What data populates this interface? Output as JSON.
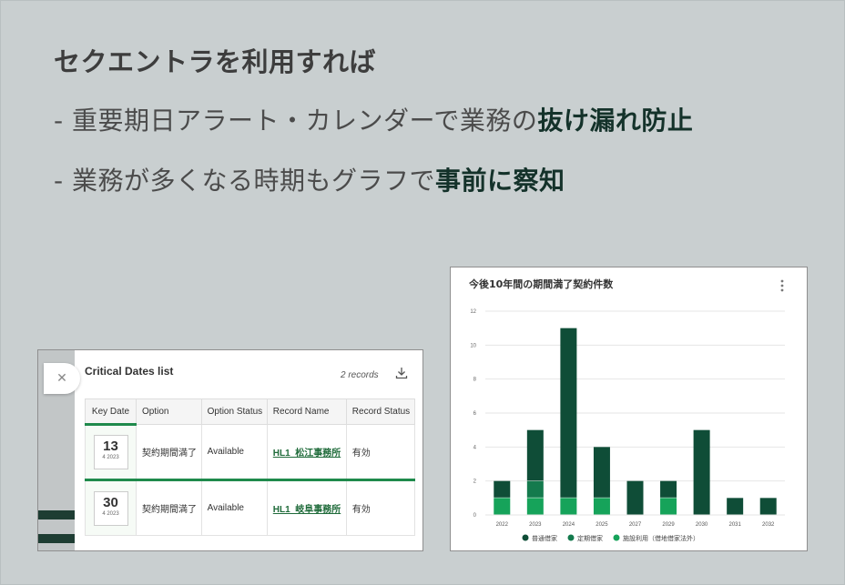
{
  "headline": "セクエントラを利用すれば",
  "bullets": [
    {
      "prefix": "- 重要期日アラート・カレンダーで業務の",
      "emphasis": "抜け漏れ防止"
    },
    {
      "prefix": "- 業務が多くなる時期もグラフで",
      "emphasis": "事前に察知"
    }
  ],
  "critical_dates": {
    "title": "Critical Dates list",
    "records": "2 records",
    "columns": [
      "Key Date",
      "Option",
      "Option Status",
      "Record Name",
      "Record Status"
    ],
    "rows": [
      {
        "day": "13",
        "month_year": "4 2023",
        "option": "契約期間満了",
        "option_status": "Available",
        "record_name": "HL1_松江事務所",
        "record_status": "有効"
      },
      {
        "day": "30",
        "month_year": "4 2023",
        "option": "契約期間満了",
        "option_status": "Available",
        "record_name": "HL1_岐阜事務所",
        "record_status": "有効"
      }
    ]
  },
  "chart_data": {
    "type": "bar",
    "stacked": true,
    "title": "今後10年間の期間満了契約件数",
    "categories": [
      "2022",
      "2023",
      "2024",
      "2025",
      "2027",
      "2029",
      "2030",
      "2031",
      "2032"
    ],
    "series": [
      {
        "name": "普通借家",
        "color": "#0f4d37",
        "values": [
          1,
          3,
          10,
          3,
          2,
          1,
          5,
          1,
          1
        ]
      },
      {
        "name": "定期借家",
        "color": "#147a4d",
        "values": [
          0,
          1,
          0,
          0,
          0,
          0,
          0,
          0,
          0
        ]
      },
      {
        "name": "施設利用（借地借家法外）",
        "color": "#16a35a",
        "values": [
          1,
          1,
          1,
          1,
          0,
          1,
          0,
          0,
          0
        ]
      }
    ],
    "yticks": [
      "0",
      "2",
      "4",
      "6",
      "8",
      "10",
      "12"
    ],
    "ylim": [
      0,
      12
    ],
    "grid": true,
    "legend": "bottom"
  }
}
